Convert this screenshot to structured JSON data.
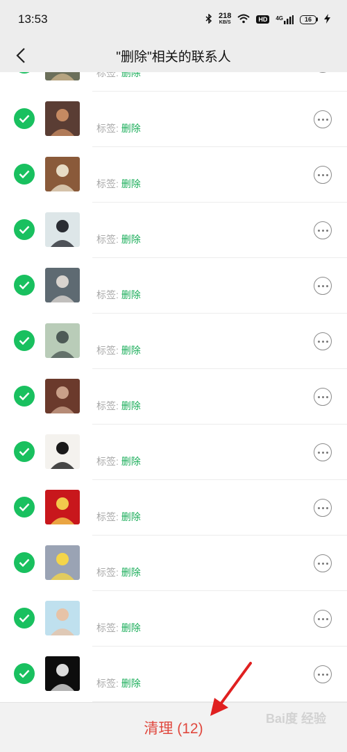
{
  "status": {
    "time": "13:53",
    "speed_value": "218",
    "speed_unit": "KB/S",
    "hd": "HD",
    "network": "4G",
    "battery": "16"
  },
  "nav": {
    "title": "\"删除\"相关的联系人"
  },
  "contacts": [
    {
      "tag_label": "标签: ",
      "tag_value": "删除",
      "avatar_bg": "#6b6f5a",
      "avatar_fg": "#c9b28a"
    },
    {
      "tag_label": "标签: ",
      "tag_value": "删除",
      "avatar_bg": "#5a3d34",
      "avatar_fg": "#c58a62"
    },
    {
      "tag_label": "标签: ",
      "tag_value": "删除",
      "avatar_bg": "#8a5a3a",
      "avatar_fg": "#e7dcc6"
    },
    {
      "tag_label": "标签: ",
      "tag_value": "删除",
      "avatar_bg": "#dde6e8",
      "avatar_fg": "#2a2d33"
    },
    {
      "tag_label": "标签: ",
      "tag_value": "删除",
      "avatar_bg": "#5e6a72",
      "avatar_fg": "#d9d4cf"
    },
    {
      "tag_label": "标签: ",
      "tag_value": "删除",
      "avatar_bg": "#b9ccb8",
      "avatar_fg": "#4d5a56"
    },
    {
      "tag_label": "标签: ",
      "tag_value": "删除",
      "avatar_bg": "#6b3a2c",
      "avatar_fg": "#c9a089"
    },
    {
      "tag_label": "标签: ",
      "tag_value": "删除",
      "avatar_bg": "#f4f2ee",
      "avatar_fg": "#1a1a1a"
    },
    {
      "tag_label": "标签: ",
      "tag_value": "删除",
      "avatar_bg": "#c8171c",
      "avatar_fg": "#f2c94c"
    },
    {
      "tag_label": "标签: ",
      "tag_value": "删除",
      "avatar_bg": "#9aa3b4",
      "avatar_fg": "#f4d54a"
    },
    {
      "tag_label": "标签: ",
      "tag_value": "删除",
      "avatar_bg": "#bfe0ee",
      "avatar_fg": "#e7c3a7"
    },
    {
      "tag_label": "标签: ",
      "tag_value": "删除",
      "avatar_bg": "#0d0d0d",
      "avatar_fg": "#dcdcdc"
    }
  ],
  "footer": {
    "clean_label": "清理 (12)",
    "watermark": "Bai度 经验"
  },
  "colors": {
    "accent_green": "#1aad59",
    "danger_red": "#e0483e"
  }
}
